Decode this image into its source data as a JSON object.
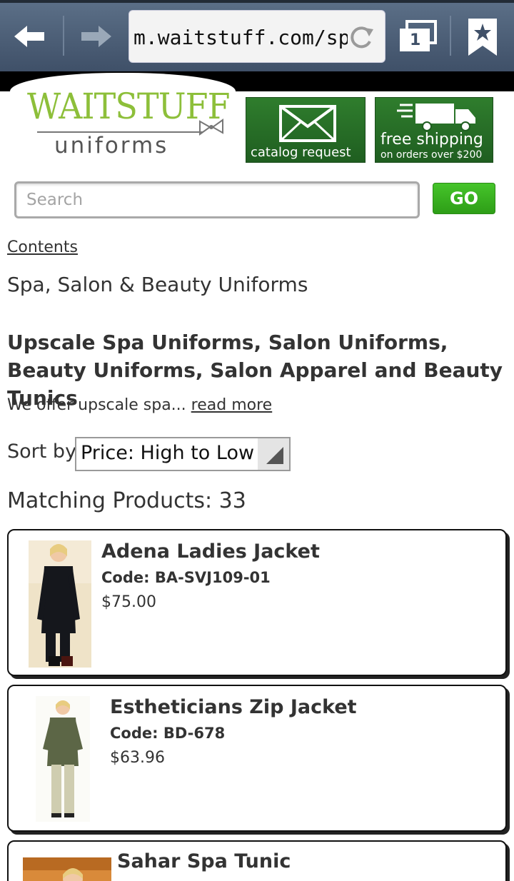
{
  "browser": {
    "url": "m.waitstuff.com/spa-",
    "tab_count": "1",
    "icons": [
      "back-arrow-icon",
      "forward-arrow-icon",
      "reload-icon",
      "tabs-icon",
      "bookmark-star-icon"
    ]
  },
  "header": {
    "logo_top": "WAITSTUFF",
    "logo_bottom": "uniforms",
    "catalog_banner": "catalog request",
    "shipping_banner_line1": "free shipping",
    "shipping_banner_line2": "on orders over $200",
    "brand_green": "#8dbf3a",
    "banner_green": "#2f7d2d"
  },
  "search": {
    "placeholder": "Search",
    "button_label": "GO",
    "button_color": "#3cb521"
  },
  "content": {
    "contents_link": "Contents",
    "category_title": "Spa, Salon & Beauty Uniforms",
    "heading": "Upscale Spa Uniforms, Salon Uniforms, Beauty Uniforms, Salon Apparel and Beauty Tunics",
    "intro_text": "We offer upscale spa...",
    "read_more": "read more",
    "sort_label": "Sort by",
    "sort_value": "Price: High to Low",
    "matching_label": "Matching Products: 33"
  },
  "products": [
    {
      "name": "Adena Ladies Jacket",
      "code": "Code: BA-SVJ109-01",
      "price": "$75.00"
    },
    {
      "name": "Estheticians Zip Jacket",
      "code": "Code: BD-678",
      "price": "$63.96"
    },
    {
      "name": "Sahar Spa Tunic",
      "code": "",
      "price": ""
    }
  ]
}
